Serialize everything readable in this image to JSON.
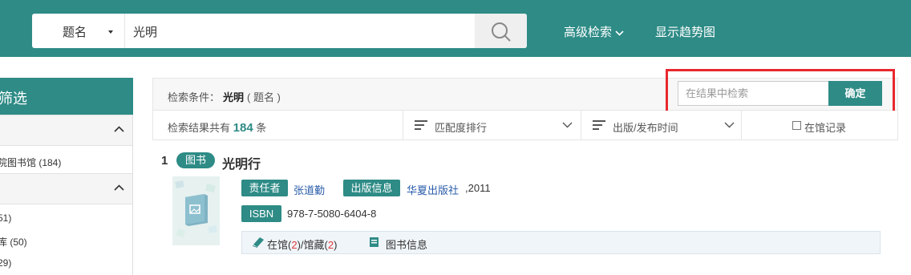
{
  "search": {
    "field": "题名",
    "query": "光明"
  },
  "nav": {
    "advanced": "高级检索",
    "trend": "显示趋势图"
  },
  "sidebar": {
    "title": "筛选",
    "item1": "院图书馆 (184)",
    "item2": "51)",
    "item3": "库 (50)",
    "item4": "29)"
  },
  "condition": {
    "label": "检索条件：",
    "term": "光明",
    "field": "( 题名 )"
  },
  "refine": {
    "placeholder": "在结果中检索",
    "button": "确定"
  },
  "sortbar": {
    "count_prefix": "检索结果共有",
    "count": "184",
    "count_suffix": "条",
    "sort1": "匹配度排行",
    "sort2": "出版/发布时间",
    "checkbox": "在馆记录"
  },
  "result": {
    "index": "1",
    "type": "图书",
    "title": "光明行",
    "author_label": "责任者",
    "author": "张道勤",
    "pub_label": "出版信息",
    "publisher": "华夏出版社",
    "year": ",2011",
    "isbn_label": "ISBN",
    "isbn": "978-7-5080-6404-8",
    "holding_prefix": "在馆(",
    "holding_in": "2",
    "holding_mid": ")/馆藏(",
    "holding_total": "2",
    "holding_suffix": ")",
    "info": "图书信息"
  },
  "colors": {
    "accent": "#2e8b86",
    "highlight": "#e8282e",
    "link": "#2a5caa"
  }
}
